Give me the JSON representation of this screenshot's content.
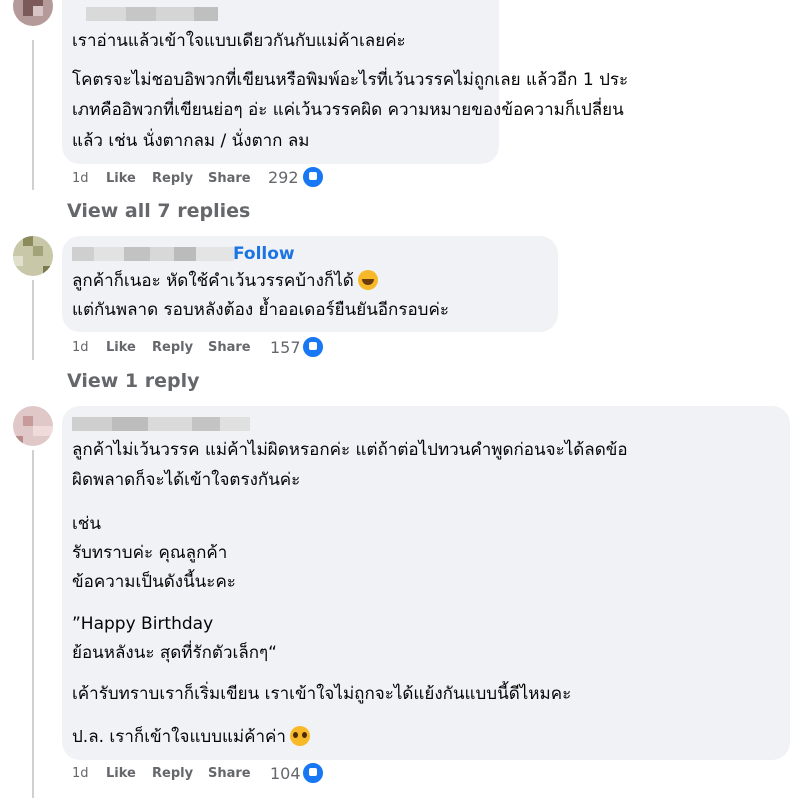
{
  "comments": [
    {
      "lines": [
        "เราอ่านแล้วเข้าใจแบบเดียวกันกับแม่ค้าเลยค่ะ",
        "โคตรจะไม่ชอบอิพวกที่เขียนหรือพิมพ์อะไรที่เว้นวรรคไม่ถูกเลย แล้วอีก 1 ประ",
        "เภทคืออิพวกที่เขียนย่อๆ อ่ะ แค่เว้นวรรคผิด ความหมายของข้อความก็เปลี่ยน",
        "แล้ว เช่น นั่งตากลม / นั่งตาก ลม"
      ],
      "time": "1d",
      "like": "Like",
      "reply": "Reply",
      "share": "Share",
      "reactions": "292",
      "view_replies": "View all 7 replies"
    },
    {
      "follow": "Follow",
      "lines": [
        "ลูกค้าก็เนอะ หัดใช้คำเว้นวรรคบ้างก็ได้",
        "แต่กันพลาด รอบหลังต้อง ย้ำออเดอร์ยืนยันอีกรอบค่ะ"
      ],
      "emoji": "rolling-laughing-emoji",
      "time": "1d",
      "like": "Like",
      "reply": "Reply",
      "share": "Share",
      "reactions": "157",
      "view_replies": "View 1 reply"
    },
    {
      "lines": [
        "ลูกค้าไม่เว้นวรรค แม่ค้าไม่ผิดหรอกค่ะ แต่ถ้าต่อไปทวนคำพูดก่อนจะได้ลดข้อ",
        "ผิดพลาดก็จะได้เข้าใจตรงกันค่ะ",
        "เช่น",
        "รับทราบค่ะ คุณลูกค้า",
        "ข้อความเป็นดังนี้นะคะ",
        "”Happy Birthday",
        "ย้อนหลังนะ สุดที่รักตัวเล็กๆ“",
        "เค้ารับทราบเราก็เริ่มเขียน เราเข้าใจไม่ถูกจะได้แย้งกันแบบนี้ดีไหมคะ",
        "ป.ล. เราก็เข้าใจแบบแม่ค้าค่า"
      ],
      "emoji": "pleading-face-emoji",
      "time": "1d",
      "like": "Like",
      "reply": "Reply",
      "share": "Share",
      "reactions": "104"
    }
  ],
  "colors": {
    "bubble": "#f0f2f5",
    "link": "#1b74e4",
    "meta": "#65676b",
    "like_badge": "#1877f2"
  }
}
